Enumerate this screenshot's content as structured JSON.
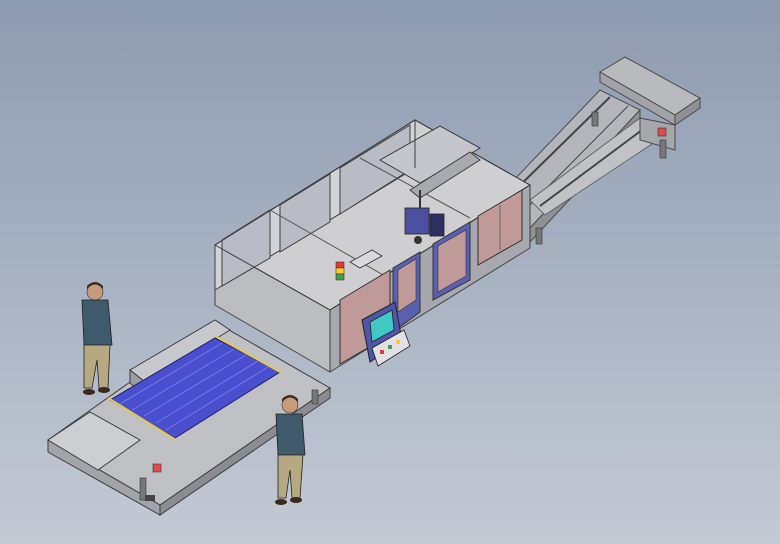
{
  "scene": {
    "background_top": "#8d9bb0",
    "background_bottom": "#c4cad4",
    "machine_body_color": "#c9c9cc",
    "frame_color": "#b9bdc6",
    "glass_panel_color": "#c09a98",
    "door_accent_color": "#5a5fb0",
    "workpiece_color": "#4a4fd0",
    "control_panel_color": "#4f56a8",
    "screen_color": "#3ec9c4",
    "beacon_colors": [
      "#e53935",
      "#ffca28",
      "#43a047"
    ],
    "person_shirt_color": "#3f5a6a",
    "person_pants_color": "#b6a880",
    "icons": [
      "person-icon",
      "control-panel-icon",
      "signal-beacon-icon"
    ]
  }
}
